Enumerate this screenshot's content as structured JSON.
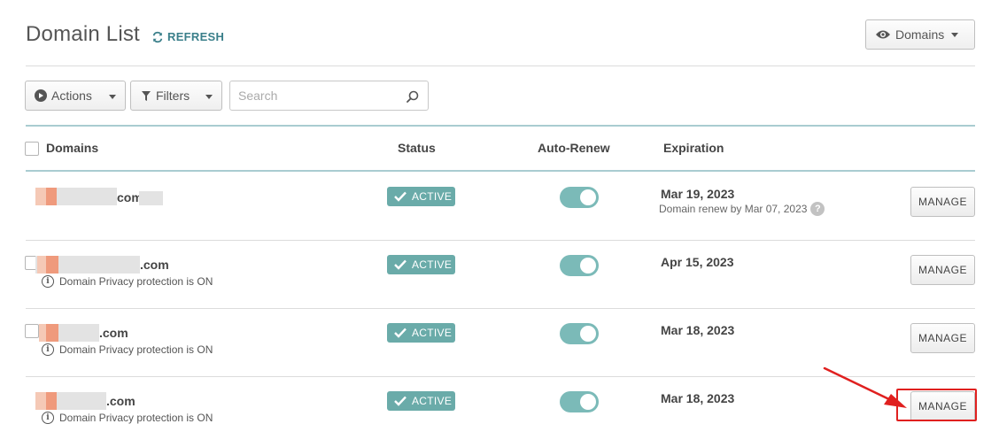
{
  "header": {
    "title": "Domain List",
    "refresh_label": "REFRESH",
    "view_button_label": "Domains"
  },
  "toolbar": {
    "actions_label": "Actions",
    "filters_label": "Filters",
    "search_placeholder": "Search",
    "search_value": ""
  },
  "table": {
    "columns": [
      "Domains",
      "Status",
      "Auto-Renew",
      "Expiration"
    ],
    "rows": [
      {
        "domain_suffix": "com",
        "status": "ACTIVE",
        "auto_renew": true,
        "expiration": "Mar 19, 2023",
        "renew_note": "Domain renew by Mar 07, 2023",
        "privacy_note": "",
        "manage_label": "MANAGE"
      },
      {
        "domain_suffix": ".com",
        "status": "ACTIVE",
        "auto_renew": true,
        "expiration": "Apr 15, 2023",
        "renew_note": "",
        "privacy_note": "Domain Privacy protection is ON",
        "manage_label": "MANAGE"
      },
      {
        "domain_suffix": ".com",
        "status": "ACTIVE",
        "auto_renew": true,
        "expiration": "Mar 18, 2023",
        "renew_note": "",
        "privacy_note": "Domain Privacy protection is ON",
        "manage_label": "MANAGE"
      },
      {
        "domain_suffix": ".com",
        "status": "ACTIVE",
        "auto_renew": true,
        "expiration": "Mar 18, 2023",
        "renew_note": "",
        "privacy_note": "Domain Privacy protection is ON",
        "manage_label": "MANAGE"
      }
    ]
  },
  "icons": {
    "refresh": "refresh-icon",
    "view": "eye-icon",
    "actions": "play-circle-icon",
    "filters": "funnel-icon",
    "search": "search-icon",
    "status": "check-icon",
    "privacy": "info-icon",
    "help": "question-icon"
  },
  "colors": {
    "accent": "#3a7f8a",
    "status_active": "#6aaba9",
    "toggle_on": "#7bbab8",
    "highlight": "#e0201f",
    "header_rule": "#a9ccd1"
  }
}
